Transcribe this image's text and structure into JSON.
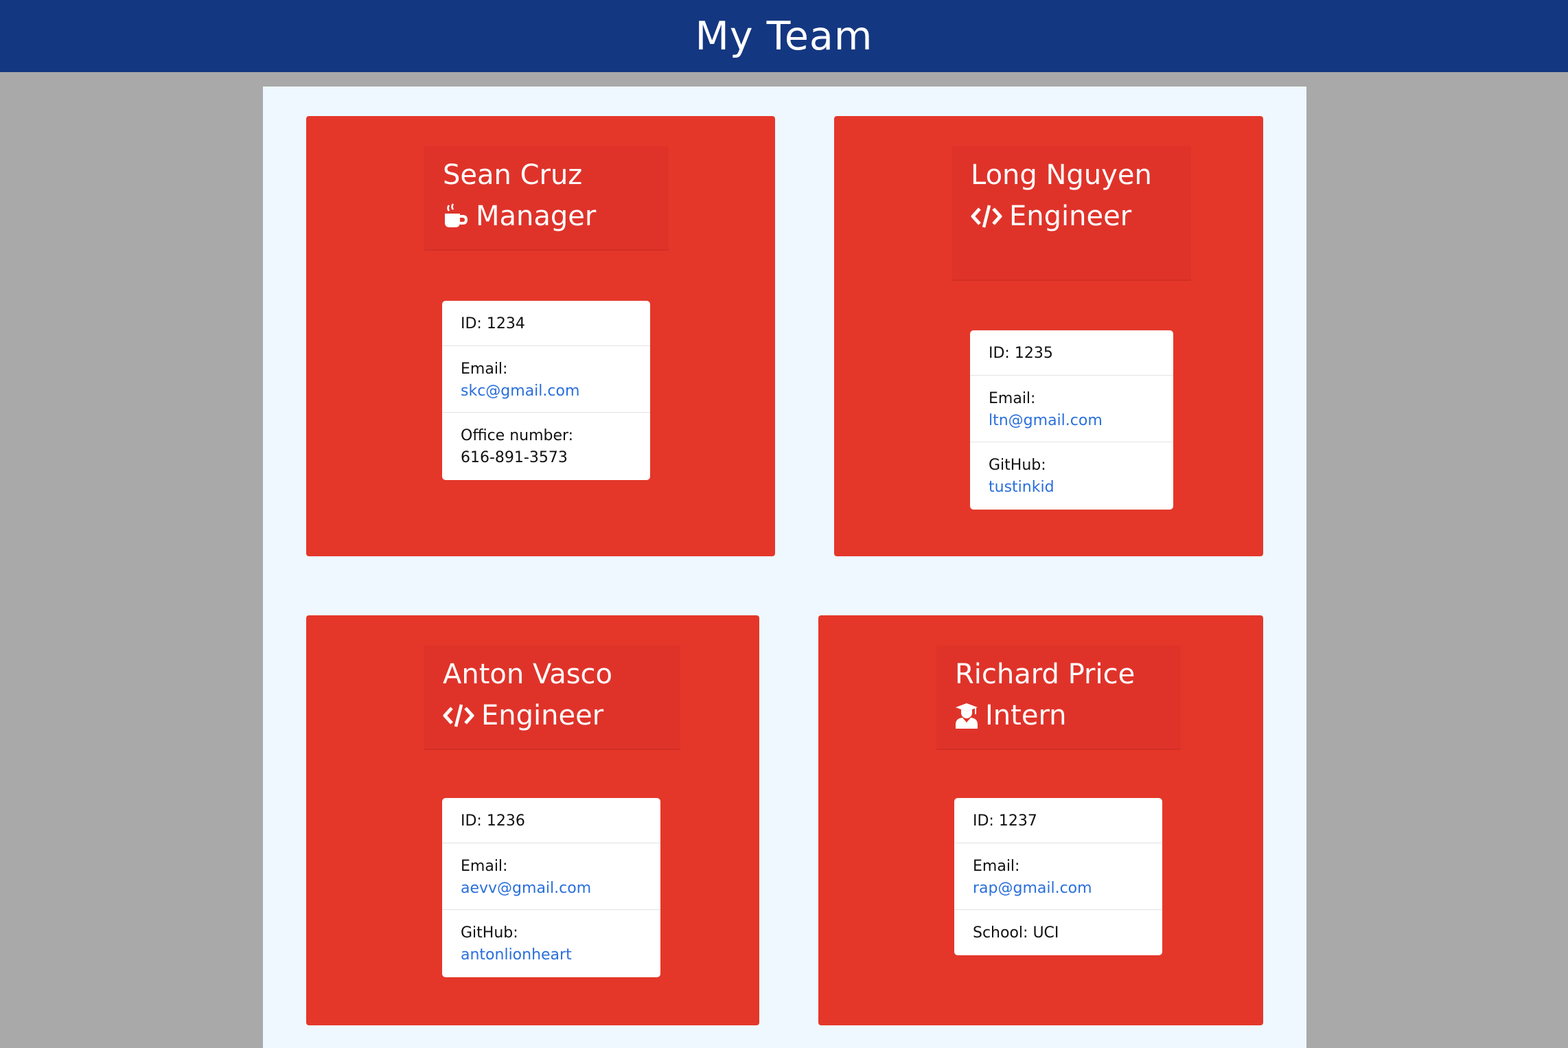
{
  "header": {
    "title": "My Team"
  },
  "colors": {
    "header_bg": "#143781",
    "page_bg": "#a9a9a9",
    "main_bg": "#f0f8ff",
    "card_bg": "#e4372a",
    "link": "#2a6fdb"
  },
  "employees": [
    {
      "name": "Sean Cruz",
      "role": "Manager",
      "role_icon": "mug-hot-icon",
      "id_label": "ID: 1234",
      "email_label": "Email:",
      "email": "skc@gmail.com",
      "extra_label": "Office number:",
      "extra_value": "616-891-3573"
    },
    {
      "name": "Long Nguyen",
      "role": "Engineer",
      "role_icon": "code-icon",
      "id_label": "ID: 1235",
      "email_label": "Email:",
      "email": "ltn@gmail.com",
      "extra_label": "GitHub:",
      "extra_value": "tustinkid"
    },
    {
      "name": "Anton Vasco",
      "role": "Engineer",
      "role_icon": "code-icon",
      "id_label": "ID: 1236",
      "email_label": "Email:",
      "email": "aevv@gmail.com",
      "extra_label": "GitHub:",
      "extra_value": "antonlionheart"
    },
    {
      "name": "Richard Price",
      "role": "Intern",
      "role_icon": "graduate-icon",
      "id_label": "ID: 1237",
      "email_label": "Email:",
      "email": "rap@gmail.com",
      "extra_label": "School: UCI"
    }
  ]
}
